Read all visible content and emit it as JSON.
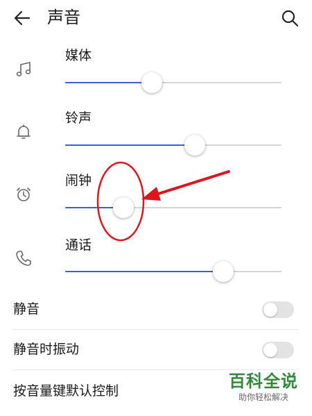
{
  "header": {
    "title": "声音",
    "back_icon": "arrow-left-icon",
    "search_icon": "search-icon"
  },
  "volumes": [
    {
      "key": "media",
      "label": "媒体",
      "icon": "music-note-icon",
      "level": 0.4
    },
    {
      "key": "ringtone",
      "label": "铃声",
      "icon": "bell-icon",
      "level": 0.6
    },
    {
      "key": "alarm",
      "label": "闹钟",
      "icon": "alarm-clock-icon",
      "level": 0.27
    },
    {
      "key": "call",
      "label": "通话",
      "icon": "phone-icon",
      "level": 0.73
    }
  ],
  "toggles": [
    {
      "key": "mute",
      "label": "静音",
      "on": false
    },
    {
      "key": "vibrate_on_mute",
      "label": "静音时振动",
      "on": false
    }
  ],
  "settings_item": {
    "label": "按音量键默认控制"
  },
  "watermark": {
    "title": "百科全说",
    "subtitle": "助你轻松解决"
  },
  "colors": {
    "slider_fill": "#3d5fd6",
    "slider_track": "#d4d4d4",
    "annotation": "#e0151b",
    "watermark": "#2f8a3a"
  }
}
